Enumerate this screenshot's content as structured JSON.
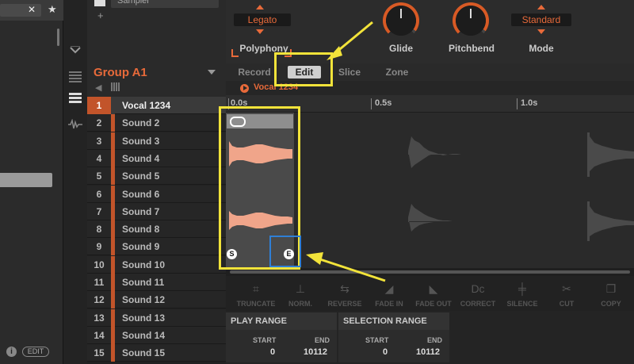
{
  "colors": {
    "accent": "#e86a3a",
    "highlight_annotation": "#f2e33a",
    "blue_annotation": "#2f7fd6",
    "waveform": "#f0a58a"
  },
  "browser": {
    "close_glyph": "✕",
    "star_glyph": "★",
    "info_glyph": "i",
    "edit_label": "EDIT"
  },
  "sampler": {
    "preset": "Sampler",
    "add_glyph": "+"
  },
  "params": {
    "polyphony_mode": "Legato",
    "polyphony_label": "Polyphony",
    "glide_label": "Glide",
    "pitchbend_label": "Pitchbend",
    "mode_value": "Standard",
    "mode_label": "Mode"
  },
  "group": {
    "title": "Group A1"
  },
  "sounds": [
    {
      "num": "1",
      "name": "Vocal 1234"
    },
    {
      "num": "2",
      "name": "Sound 2"
    },
    {
      "num": "3",
      "name": "Sound 3"
    },
    {
      "num": "4",
      "name": "Sound 4"
    },
    {
      "num": "5",
      "name": "Sound 5"
    },
    {
      "num": "6",
      "name": "Sound 6"
    },
    {
      "num": "7",
      "name": "Sound 7"
    },
    {
      "num": "8",
      "name": "Sound 8"
    },
    {
      "num": "9",
      "name": "Sound 9"
    },
    {
      "num": "10",
      "name": "Sound 10"
    },
    {
      "num": "11",
      "name": "Sound 11"
    },
    {
      "num": "12",
      "name": "Sound 12"
    },
    {
      "num": "13",
      "name": "Sound 13"
    },
    {
      "num": "14",
      "name": "Sound 14"
    },
    {
      "num": "15",
      "name": "Sound 15"
    }
  ],
  "tabs": [
    "Record",
    "Edit",
    "Slice",
    "Zone"
  ],
  "active_tab": "Edit",
  "sample_name": "Vocal 1234",
  "ruler": [
    "0.0s",
    "0.5s",
    "1.0s"
  ],
  "markers": {
    "start": "S",
    "end": "E"
  },
  "tools": [
    "TRUNCATE",
    "NORM.",
    "REVERSE",
    "FADE IN",
    "FADE OUT",
    "CORRECT",
    "SILENCE",
    "CUT",
    "COPY"
  ],
  "play_range": {
    "title": "PLAY RANGE",
    "start_label": "START",
    "end_label": "END",
    "start": "0",
    "end": "10112"
  },
  "selection_range": {
    "title": "SELECTION RANGE",
    "start_label": "START",
    "end_label": "END",
    "start": "0",
    "end": "10112"
  }
}
